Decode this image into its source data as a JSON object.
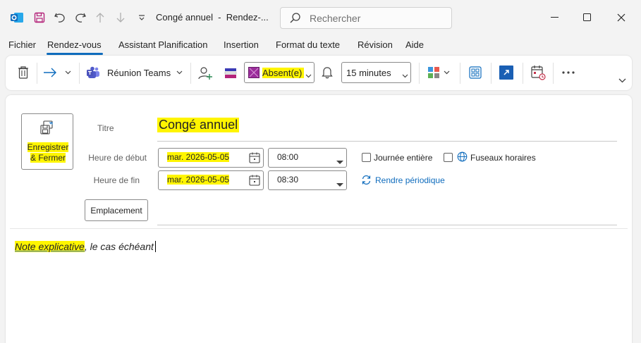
{
  "window": {
    "title": "Congé annuel  -  Rendez-...",
    "search_placeholder": "Rechercher"
  },
  "menu": {
    "items": [
      "Fichier",
      "Rendez-vous",
      "Assistant Planification",
      "Insertion",
      "Format du texte",
      "Révision",
      "Aide"
    ],
    "active": "Rendez-vous"
  },
  "ribbon": {
    "teams_label": "Réunion Teams",
    "show_as_value": "Absent(e)",
    "reminder_value": "15 minutes"
  },
  "form": {
    "save_close_line1": "Enregistrer",
    "save_close_line2": "& Fermer",
    "title_label": "Titre",
    "title_value": "Congé annuel",
    "start_label": "Heure de début",
    "start_date": "mar. 2026-05-05",
    "start_time": "08:00",
    "end_label": "Heure de fin",
    "end_date": "mar. 2026-05-05",
    "end_time": "08:30",
    "all_day_label": "Journée entière",
    "time_zones_label": "Fuseaux horaires",
    "recurrence_label": "Rendre périodique",
    "location_button": "Emplacement"
  },
  "body": {
    "text_part1": "Note explicative",
    "text_part2": ", le cas échéant"
  },
  "colors": {
    "accent": "#0f6cbd",
    "highlight": "#fff500"
  }
}
